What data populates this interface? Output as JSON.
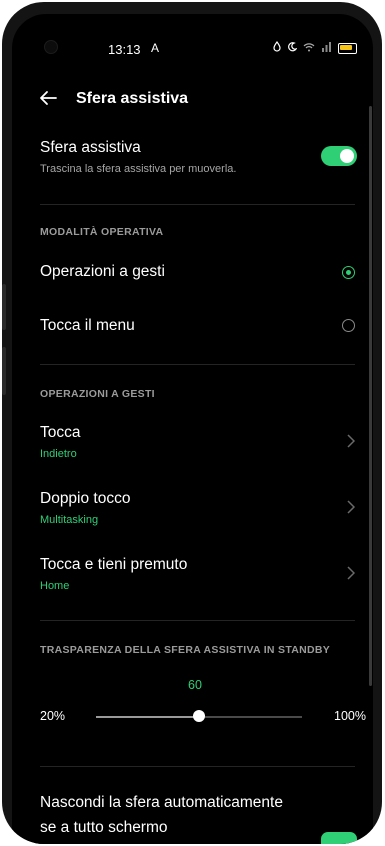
{
  "status_bar": {
    "time": "13:13",
    "notification_glyph": "A",
    "icons": [
      "drop-icon",
      "moon-icon",
      "wifi-icon",
      "signal-icon",
      "battery-icon"
    ]
  },
  "app_bar": {
    "title": "Sfera assistiva",
    "back_icon": "arrow-left-icon"
  },
  "main_setting": {
    "title": "Sfera assistiva",
    "subtitle": "Trascina la sfera assistiva per muoverla.",
    "enabled": true
  },
  "mode_section": {
    "header": "MODALITÀ OPERATIVA",
    "options": [
      {
        "label": "Operazioni a gesti",
        "selected": true
      },
      {
        "label": "Tocca il menu",
        "selected": false
      }
    ]
  },
  "gestures_section": {
    "header": "OPERAZIONI A GESTI",
    "items": [
      {
        "title": "Tocca",
        "value": "Indietro"
      },
      {
        "title": "Doppio tocco",
        "value": "Multitasking"
      },
      {
        "title": "Tocca e tieni premuto",
        "value": "Home"
      }
    ]
  },
  "transparency_section": {
    "header": "TRASPARENZA DELLA SFERA ASSISTIVA IN STANDBY",
    "value": "60",
    "min_label": "20%",
    "max_label": "100%",
    "min": 20,
    "max": 100,
    "current": 60
  },
  "autohide_setting": {
    "title_line1": "Nascondi la sfera automaticamente",
    "title_line2": "se a tutto schermo",
    "enabled": true
  },
  "colors": {
    "accent": "#2fcf76",
    "background": "#000000",
    "section_header": "#9b9b9b"
  }
}
